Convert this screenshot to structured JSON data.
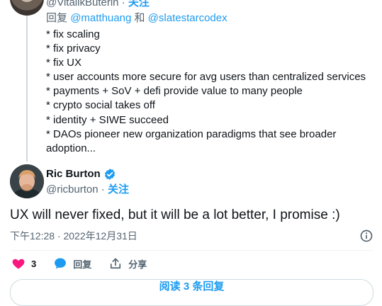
{
  "parent": {
    "handle": "@VitalikButerin",
    "follow": "关注",
    "reply_prefix": "回复",
    "reply_user1": "@matthuang",
    "reply_and": "和",
    "reply_user2": "@slatestarcodex",
    "lines": [
      "* fix scaling",
      "* fix privacy",
      "* fix UX",
      "* user accounts more secure for avg users than centralized services",
      "* payments + SoV + defi provide value to many people",
      "* crypto social takes off",
      "* identity + SIWE succeed",
      "* DAOs pioneer new organization paradigms that see broader",
      "adoption..."
    ]
  },
  "tweet": {
    "author_name": "Ric Burton",
    "handle": "@ricburton",
    "dot": "·",
    "follow": "关注",
    "text": "UX will never fixed, but it will be a lot better, I promise :)",
    "timestamp": "下午12:28 · 2022年12月31日"
  },
  "actions": {
    "like_count": "3",
    "reply_label": "回复",
    "share_label": "分享"
  },
  "bottom": {
    "label": "阅读 3 条回复"
  },
  "colors": {
    "accent": "#1d9bf0",
    "like": "#f91880",
    "text": "#0f1419",
    "secondary": "#536471"
  },
  "icons": {
    "verified": "verified-badge-icon",
    "info": "info-icon",
    "like": "heart-icon",
    "reply": "reply-bubble-icon",
    "share": "share-icon"
  }
}
